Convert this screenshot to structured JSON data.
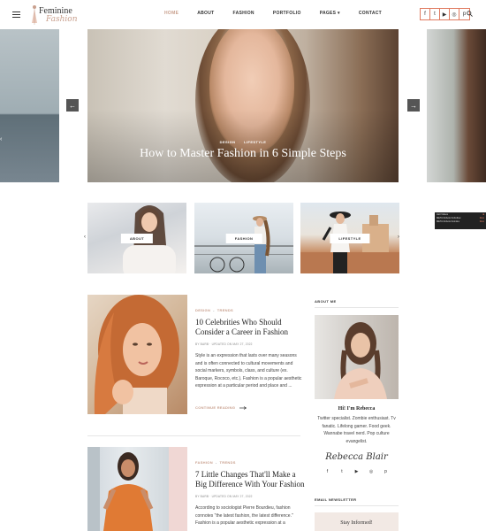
{
  "header": {
    "logo_line1": "Feminine",
    "logo_line2": "Fashion",
    "nav": [
      {
        "label": "HOME",
        "active": true
      },
      {
        "label": "ABOUT"
      },
      {
        "label": "FASHION"
      },
      {
        "label": "PORTFOLIO"
      },
      {
        "label": "PAGES"
      },
      {
        "label": "CONTACT"
      }
    ],
    "pages_caret": "▾",
    "social": [
      "facebook-icon",
      "twitter-icon",
      "youtube-icon",
      "instagram-icon",
      "pinterest-icon"
    ],
    "social_glyphs": [
      "f",
      "t",
      "▶",
      "◎",
      "p"
    ]
  },
  "hero": {
    "cat1": "DESIGN",
    "cat2": "LIFESTYLE",
    "title": "How to Master Fashion in 6 Simple Steps",
    "prev": "←",
    "next": "→"
  },
  "categories": [
    {
      "label": "ABOUT"
    },
    {
      "label": "FASHION"
    },
    {
      "label": "LIFESTYLE"
    }
  ],
  "carousel_prev": "‹",
  "carousel_next": "›",
  "widget": {
    "rows": [
      {
        "name": "Hell Videos",
        "tag": ""
      },
      {
        "name": "META Robots NoFollow",
        "tag": "Row"
      },
      {
        "name": "META Robots Noindex",
        "tag": "Row"
      }
    ]
  },
  "posts": [
    {
      "cat1": "DESIGN",
      "cat2": "TRENDS",
      "title": "10 Celebrities Who Should Consider a Career in Fashion",
      "byline": "BY BARB   ·   UPDATED ON MAY 27, 2022",
      "excerpt": "Style is an expression that lasts over many seasons and is often connected to cultural movements and social markers, symbols, class, and culture (ex. Baroque, Rococo, etc.). Fashion is a popular aesthetic expression at a particular period and place and ...",
      "cta": "CONTINUE READING"
    },
    {
      "cat1": "FASHION",
      "cat2": "TRENDS",
      "title": "7 Little Changes That'll Make a Big Difference With Your Fashion",
      "byline": "BY BARB   ·   UPDATED ON MAY 27, 2022",
      "excerpt": "According to sociologist Pierre Bourdieu, fashion connotes \"the latest fashion, the latest difference.\" Fashion is a popular aesthetic expression at a"
    }
  ],
  "sidebar": {
    "about_heading": "ABOUT ME",
    "name": "Hi! I'm Rebecca",
    "bio": "Twitter specialist. Zombie enthusiast. Tv fanatic. Lifelong gamer. Food geek. Wannabe travel nerd. Pop culture evangelist.",
    "signature": "Rebecca Blair",
    "social": [
      "facebook-icon",
      "twitter-icon",
      "youtube-icon",
      "instagram-icon",
      "pinterest-icon"
    ],
    "social_glyphs": [
      "f",
      "t",
      "▶",
      "◎",
      "p"
    ],
    "newsletter_heading": "EMAIL NEWSLETTER",
    "newsletter_box": "Stay Informed!"
  }
}
